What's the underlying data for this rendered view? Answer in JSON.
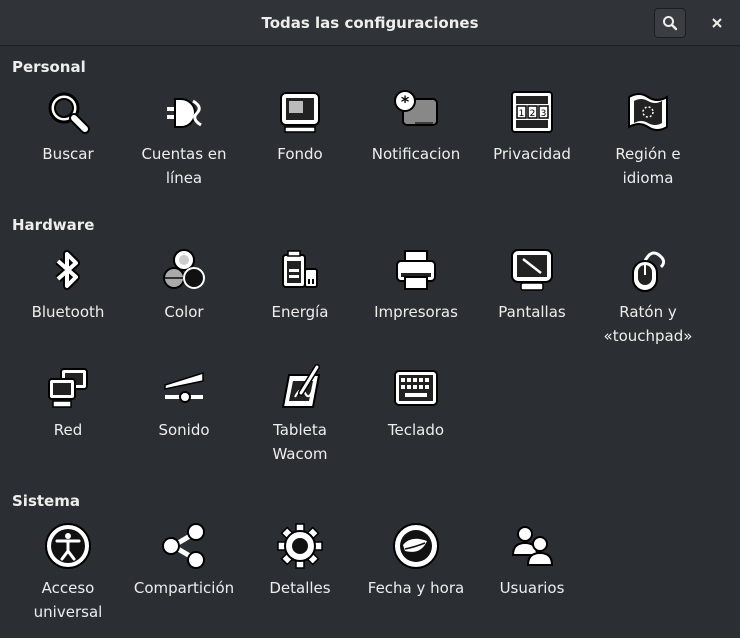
{
  "header": {
    "title": "Todas las configuraciones",
    "search_icon": "search-icon",
    "close_icon": "close-icon"
  },
  "sections": {
    "personal": {
      "title": "Personal",
      "items": [
        {
          "label": "Buscar",
          "icon": "magnifier-icon"
        },
        {
          "label": "Cuentas en línea",
          "icon": "online-accounts-icon"
        },
        {
          "label": "Fondo",
          "icon": "background-icon"
        },
        {
          "label": "Notificacion",
          "icon": "notifications-icon"
        },
        {
          "label": "Privacidad",
          "icon": "privacy-icon"
        },
        {
          "label": "Región e idioma",
          "icon": "region-flag-icon"
        }
      ]
    },
    "hardware": {
      "title": "Hardware",
      "items": [
        {
          "label": "Bluetooth",
          "icon": "bluetooth-icon"
        },
        {
          "label": "Color",
          "icon": "color-icon"
        },
        {
          "label": "Energía",
          "icon": "power-icon"
        },
        {
          "label": "Impresoras",
          "icon": "printer-icon"
        },
        {
          "label": "Pantallas",
          "icon": "display-icon"
        },
        {
          "label": "Ratón y «touchpad»",
          "icon": "mouse-icon"
        },
        {
          "label": "Red",
          "icon": "network-icon"
        },
        {
          "label": "Sonido",
          "icon": "sound-icon"
        },
        {
          "label": "Tableta Wacom",
          "icon": "wacom-tablet-icon"
        },
        {
          "label": "Teclado",
          "icon": "keyboard-icon"
        }
      ]
    },
    "sistema": {
      "title": "Sistema",
      "items": [
        {
          "label": "Acceso universal",
          "icon": "universal-access-icon"
        },
        {
          "label": "Compartición",
          "icon": "sharing-icon"
        },
        {
          "label": "Detalles",
          "icon": "details-gear-icon"
        },
        {
          "label": "Fecha y hora",
          "icon": "clock-icon"
        },
        {
          "label": "Usuarios",
          "icon": "users-icon"
        }
      ]
    }
  }
}
